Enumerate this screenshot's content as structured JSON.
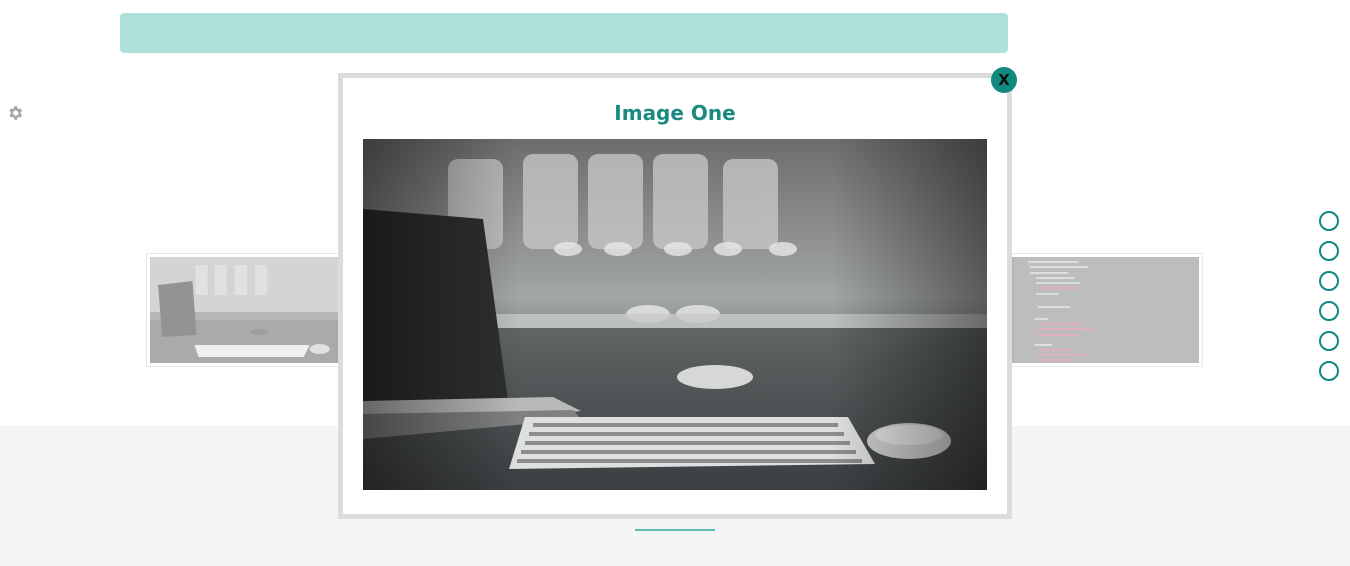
{
  "modal": {
    "title": "Image One",
    "close_label": "X"
  },
  "icons": {
    "settings": "gear-icon",
    "close": "close-icon"
  },
  "pagination": {
    "dots": 6
  },
  "colors": {
    "accent": "#11897f",
    "top_bar": "#86cfc7",
    "title_text": "#1b8a80",
    "band": "#f5f5f5"
  }
}
